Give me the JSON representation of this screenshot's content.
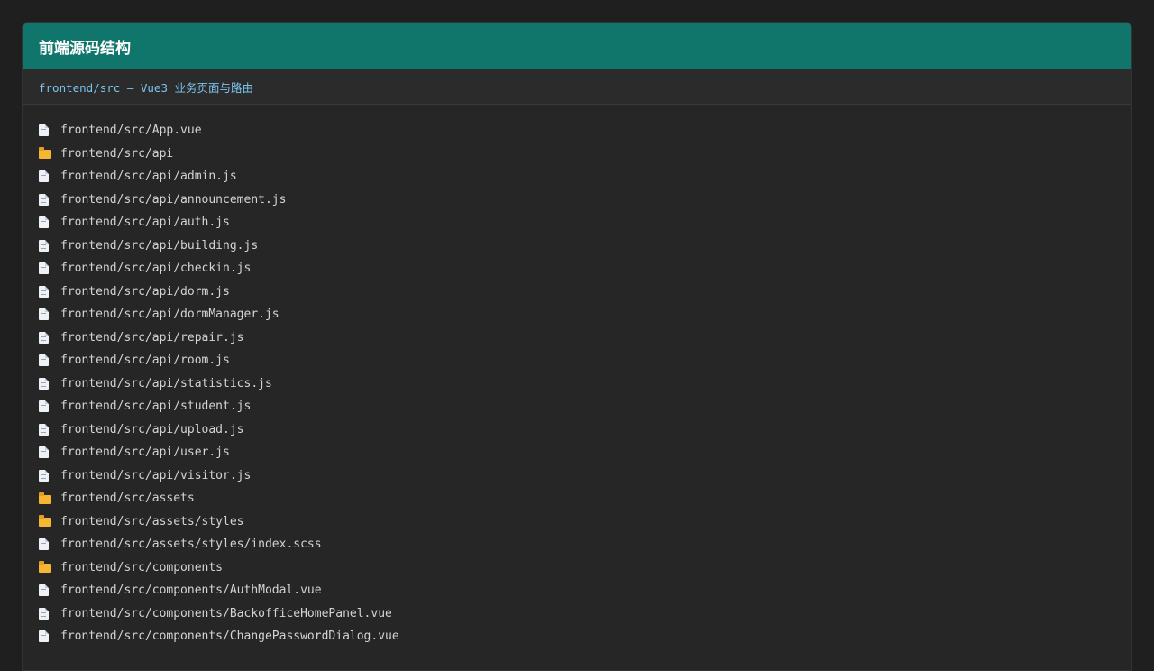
{
  "header": {
    "title": "前端源码结构"
  },
  "subheader": {
    "text": "frontend/src — Vue3 业务页面与路由"
  },
  "colors": {
    "header_bg": "#10766c",
    "subheader_text": "#7cc4f0",
    "folder_icon": "#f5b731"
  },
  "files": [
    {
      "type": "file",
      "icon": "file-icon",
      "path": "frontend/src/App.vue"
    },
    {
      "type": "folder",
      "icon": "folder-icon",
      "path": "frontend/src/api"
    },
    {
      "type": "file",
      "icon": "file-icon",
      "path": "frontend/src/api/admin.js"
    },
    {
      "type": "file",
      "icon": "file-icon",
      "path": "frontend/src/api/announcement.js"
    },
    {
      "type": "file",
      "icon": "file-icon",
      "path": "frontend/src/api/auth.js"
    },
    {
      "type": "file",
      "icon": "file-icon",
      "path": "frontend/src/api/building.js"
    },
    {
      "type": "file",
      "icon": "file-icon",
      "path": "frontend/src/api/checkin.js"
    },
    {
      "type": "file",
      "icon": "file-icon",
      "path": "frontend/src/api/dorm.js"
    },
    {
      "type": "file",
      "icon": "file-icon",
      "path": "frontend/src/api/dormManager.js"
    },
    {
      "type": "file",
      "icon": "file-icon",
      "path": "frontend/src/api/repair.js"
    },
    {
      "type": "file",
      "icon": "file-icon",
      "path": "frontend/src/api/room.js"
    },
    {
      "type": "file",
      "icon": "file-icon",
      "path": "frontend/src/api/statistics.js"
    },
    {
      "type": "file",
      "icon": "file-icon",
      "path": "frontend/src/api/student.js"
    },
    {
      "type": "file",
      "icon": "file-icon",
      "path": "frontend/src/api/upload.js"
    },
    {
      "type": "file",
      "icon": "file-icon",
      "path": "frontend/src/api/user.js"
    },
    {
      "type": "file",
      "icon": "file-icon",
      "path": "frontend/src/api/visitor.js"
    },
    {
      "type": "folder",
      "icon": "folder-icon",
      "path": "frontend/src/assets"
    },
    {
      "type": "folder",
      "icon": "folder-icon",
      "path": "frontend/src/assets/styles"
    },
    {
      "type": "file",
      "icon": "file-icon",
      "path": "frontend/src/assets/styles/index.scss"
    },
    {
      "type": "folder",
      "icon": "folder-icon",
      "path": "frontend/src/components"
    },
    {
      "type": "file",
      "icon": "file-icon",
      "path": "frontend/src/components/AuthModal.vue"
    },
    {
      "type": "file",
      "icon": "file-icon",
      "path": "frontend/src/components/BackofficeHomePanel.vue"
    },
    {
      "type": "file",
      "icon": "file-icon",
      "path": "frontend/src/components/ChangePasswordDialog.vue"
    }
  ]
}
